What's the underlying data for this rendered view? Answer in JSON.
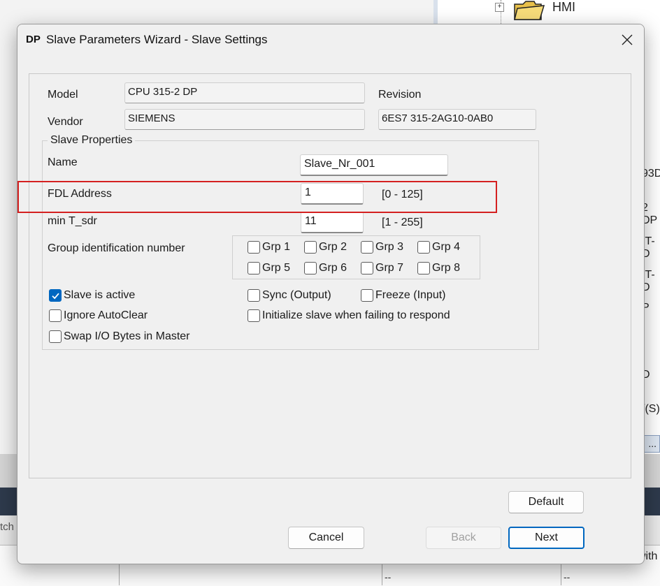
{
  "background": {
    "tree_node_label": "HMI",
    "tree_fragments": [
      "93D",
      "2 DP",
      "IT-D",
      "IT-D",
      "P",
      ".",
      "D",
      "/(S)"
    ],
    "ellipsis_label": "...",
    "switch_fragment": "tch",
    "with_fragment": "with",
    "table_cells": [
      "--",
      "--"
    ]
  },
  "dialog": {
    "logo": "DP",
    "title": "Slave Parameters Wizard - Slave Settings",
    "model_label": "Model",
    "model_value": "CPU 315-2 DP",
    "vendor_label": "Vendor",
    "vendor_value": "SIEMENS",
    "revision_label": "Revision",
    "revision_value": "6ES7 315-2AG10-0AB0",
    "slave_properties": {
      "legend": "Slave Properties",
      "name_label": "Name",
      "name_value": "Slave_Nr_001",
      "fdl_label": "FDL Address",
      "fdl_value": "1",
      "fdl_range": "[0 - 125]",
      "tsdr_label": "min T_sdr",
      "tsdr_value": "11",
      "tsdr_range": "[1 - 255]",
      "group_label": "Group identification number",
      "groups": [
        {
          "label": "Grp 1",
          "checked": false
        },
        {
          "label": "Grp 2",
          "checked": false
        },
        {
          "label": "Grp 3",
          "checked": false
        },
        {
          "label": "Grp 4",
          "checked": false
        },
        {
          "label": "Grp 5",
          "checked": false
        },
        {
          "label": "Grp 6",
          "checked": false
        },
        {
          "label": "Grp 7",
          "checked": false
        },
        {
          "label": "Grp 8",
          "checked": false
        }
      ],
      "options": {
        "slave_active": {
          "label": "Slave is active",
          "checked": true
        },
        "sync_output": {
          "label": "Sync (Output)",
          "checked": false
        },
        "freeze_input": {
          "label": "Freeze (Input)",
          "checked": false
        },
        "ignore_autoclear": {
          "label": "Ignore AutoClear",
          "checked": false
        },
        "init_slave": {
          "label": "Initialize slave when failing to respond",
          "checked": false
        },
        "swap_io": {
          "label": "Swap I/O Bytes in Master",
          "checked": false
        }
      }
    },
    "buttons": {
      "default": "Default",
      "cancel": "Cancel",
      "back": "Back",
      "next": "Next"
    },
    "accent_color": "#0067c0",
    "highlight_color": "#d42020"
  }
}
